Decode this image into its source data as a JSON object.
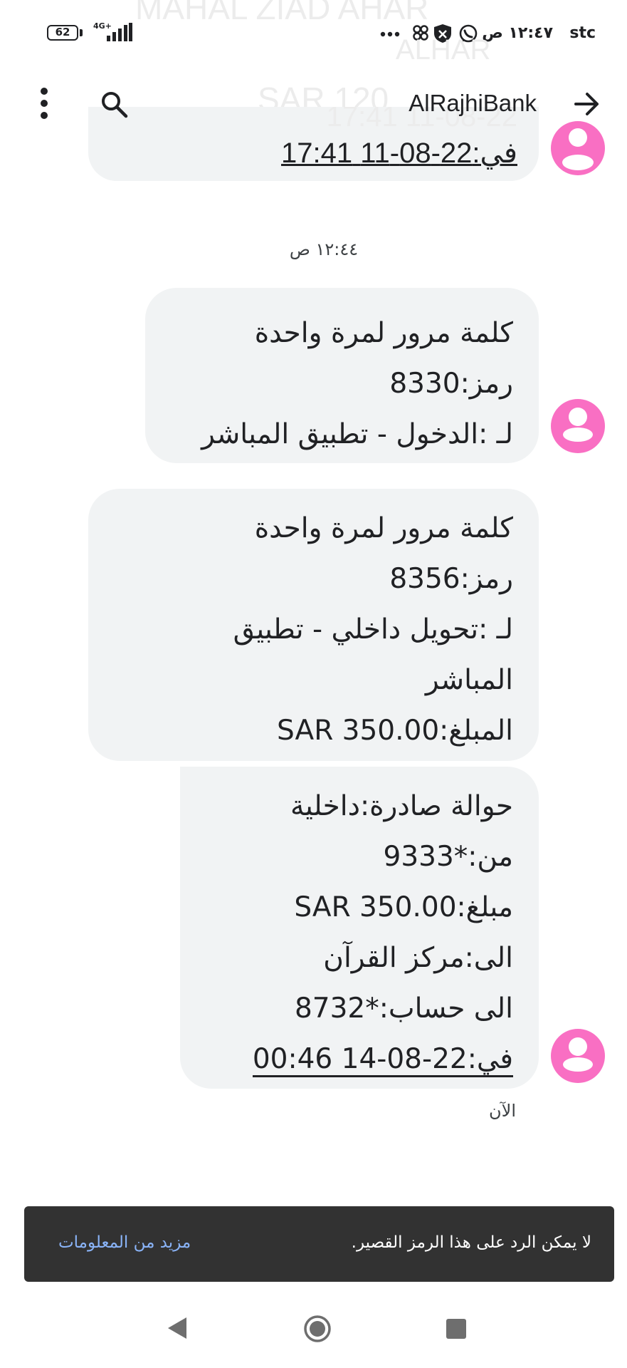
{
  "status_bar": {
    "battery": "62",
    "network_type": "4G+",
    "carrier": "stc",
    "time": "١٢:٤٧ ص"
  },
  "ghost_header": {
    "line1": "MAHAL ZIAD AHAR",
    "line2": "ALHAR",
    "line3": "SAR 120",
    "line4": "17:41 11-08-22"
  },
  "app_bar": {
    "contact_name": "AlRajhiBank",
    "icons": [
      "more-vert-icon",
      "search-icon",
      "arrow-forward-icon"
    ]
  },
  "previous_message_fragment": "في:22-08-11 17:41",
  "conversation": {
    "timestamp": "١٢:٤٤ ص",
    "messages": [
      {
        "lines": [
          "كلمة مرور لمرة واحدة",
          "رمز:8330",
          "لـ :الدخول - تطبيق المباشر"
        ]
      },
      {
        "lines": [
          "كلمة مرور لمرة واحدة",
          "رمز:8356",
          "لـ :تحويل داخلي - تطبيق",
          "المباشر",
          "المبلغ:SAR 350.00"
        ]
      },
      {
        "lines": [
          "حوالة صادرة:داخلية",
          "من:*9333",
          "مبلغ:SAR 350.00",
          "الى:مركز القرآن",
          "الى حساب:*8732",
          "في:22-08-14 00:46"
        ]
      }
    ],
    "status": "الآن"
  },
  "snackbar": {
    "message": "لا يمكن الرد على هذا الرمز القصير.",
    "action": "مزيد من المعلومات"
  },
  "nav_bar": {
    "icons": [
      "nav-back-icon",
      "nav-home-icon",
      "nav-recents-icon"
    ]
  },
  "colors": {
    "avatar": "#f96fc3",
    "bubble": "#f1f3f4",
    "snackbar": "#323232",
    "snackbar_action": "#8ab4f8"
  }
}
